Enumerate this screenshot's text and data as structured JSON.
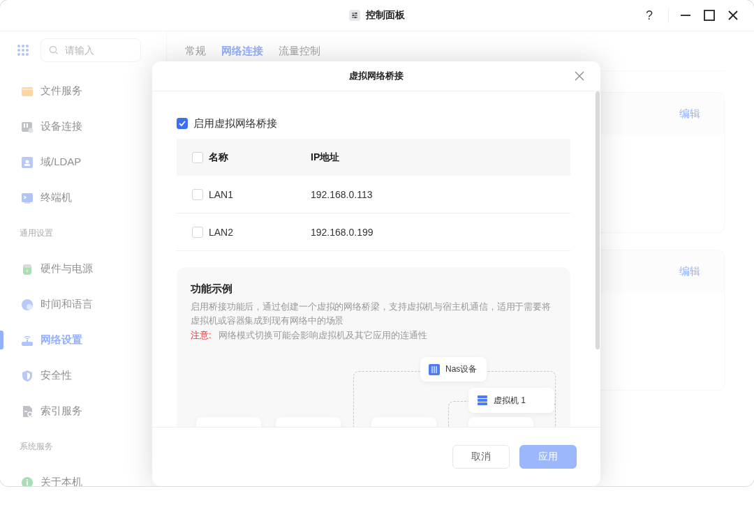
{
  "window": {
    "title": "控制面板",
    "help": "?"
  },
  "sidebar": {
    "search": {
      "placeholder": "请输入"
    },
    "items": [
      {
        "kind": "item",
        "label": "文件服务",
        "selected": false
      },
      {
        "kind": "item",
        "label": "设备连接",
        "selected": false
      },
      {
        "kind": "item",
        "label": "域/LDAP",
        "selected": false
      },
      {
        "kind": "item",
        "label": "终端机",
        "selected": false
      },
      {
        "kind": "section",
        "label": "通用设置"
      },
      {
        "kind": "item",
        "label": "硬件与电源",
        "selected": false
      },
      {
        "kind": "item",
        "label": "时间和语言",
        "selected": false
      },
      {
        "kind": "item",
        "label": "网络设置",
        "selected": true
      },
      {
        "kind": "item",
        "label": "安全性",
        "selected": false
      },
      {
        "kind": "item",
        "label": "索引服务",
        "selected": false
      },
      {
        "kind": "section",
        "label": "系统服务"
      },
      {
        "kind": "item",
        "label": "关于本机",
        "selected": false
      }
    ]
  },
  "tabs": [
    {
      "label": "常规",
      "selected": false
    },
    {
      "label": "网络连接",
      "selected": true
    },
    {
      "label": "流量控制",
      "selected": false
    }
  ],
  "cards": [
    {
      "action": "编辑"
    },
    {
      "action": "编辑"
    }
  ],
  "dialog": {
    "title": "虚拟网络桥接",
    "enable": {
      "label": "启用虚拟网络桥接",
      "checked": true
    },
    "table": {
      "columns": [
        "名称",
        "IP地址"
      ],
      "all_checked": false,
      "rows": [
        {
          "name": "LAN1",
          "ip": "192.168.0.113",
          "checked": false
        },
        {
          "name": "LAN2",
          "ip": "192.168.0.199",
          "checked": false
        }
      ]
    },
    "example": {
      "title": "功能示例",
      "description": "启用桥接功能后，通过创建一个虚拟的网络桥梁，支持虚拟机与宿主机通信，适用于需要将虚拟机或容器集成到现有网络中的场景",
      "note_label": "注意:",
      "note": "网络模式切换可能会影响虚拟机及其它应用的连通性",
      "diagram": {
        "host": "Nas设备",
        "vm": "虚拟机 1"
      }
    },
    "buttons": [
      {
        "label": "取消",
        "kind": "secondary",
        "disabled": false
      },
      {
        "label": "应用",
        "kind": "primary",
        "disabled": true
      }
    ]
  }
}
